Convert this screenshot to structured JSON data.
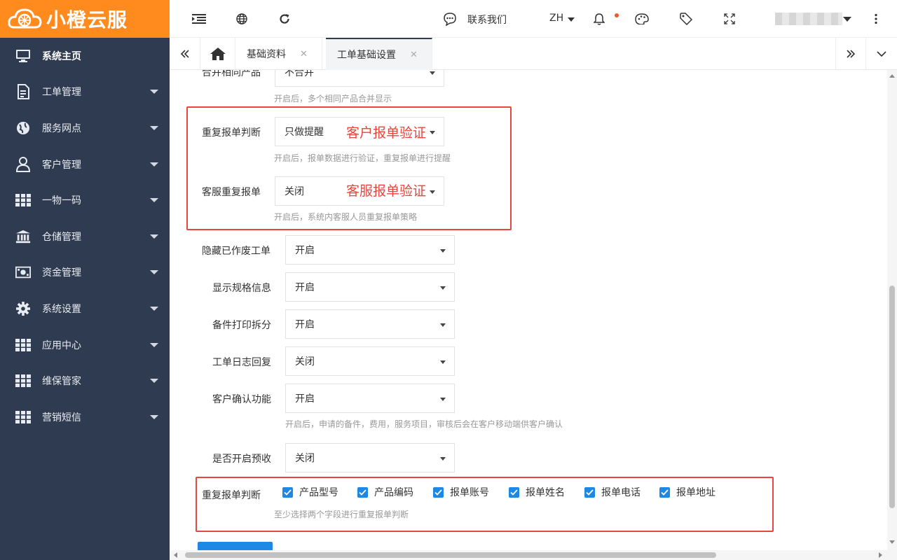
{
  "brand": {
    "name": "小橙云服"
  },
  "sidebar": {
    "items": [
      {
        "label": "系统主页",
        "icon": "monitor-icon"
      },
      {
        "label": "工单管理",
        "icon": "document-icon"
      },
      {
        "label": "服务网点",
        "icon": "globe-icon"
      },
      {
        "label": "客户管理",
        "icon": "user-icon"
      },
      {
        "label": "一物一码",
        "icon": "grid-icon"
      },
      {
        "label": "仓储管理",
        "icon": "bank-icon"
      },
      {
        "label": "资金管理",
        "icon": "money-icon"
      },
      {
        "label": "系统设置",
        "icon": "gear-icon"
      },
      {
        "label": "应用中心",
        "icon": "grid-icon"
      },
      {
        "label": "维保管家",
        "icon": "grid-icon"
      },
      {
        "label": "营销短信",
        "icon": "grid-icon"
      }
    ]
  },
  "topbar": {
    "contact_label": "联系我们",
    "language": "ZH"
  },
  "tabs": {
    "items": [
      {
        "label": "基础资料"
      },
      {
        "label": "工单基础设置"
      }
    ]
  },
  "form": {
    "merge": {
      "label": "合并相同产品",
      "value": "不合并",
      "hint": "开启后，多个相同产品合并显示"
    },
    "duplicate_check": {
      "label": "重复报单判断",
      "value": "只做提醒",
      "hint": "开启后，报单数据进行验证，重复报单进行提醒",
      "annotation": "客户报单验证"
    },
    "service_duplicate": {
      "label": "客服重复报单",
      "value": "关闭",
      "hint": "开启后，系统内客服人员重复报单策略",
      "annotation": "客服报单验证"
    },
    "hide_void": {
      "label": "隐藏已作废工单",
      "value": "开启"
    },
    "show_spec": {
      "label": "显示规格信息",
      "value": "开启"
    },
    "print_split": {
      "label": "备件打印拆分",
      "value": "开启"
    },
    "log_reply": {
      "label": "工单日志回复",
      "value": "关闭"
    },
    "customer_confirm": {
      "label": "客户确认功能",
      "value": "开启",
      "hint": "开启后，申请的备件，费用，服务项目，审核后会在客户移动端供客户确认"
    },
    "prepay": {
      "label": "是否开启预收",
      "value": "关闭"
    },
    "duplicate_fields": {
      "label": "重复报单判断",
      "options": [
        {
          "label": "产品型号",
          "checked": true
        },
        {
          "label": "产品编码",
          "checked": true
        },
        {
          "label": "报单账号",
          "checked": true
        },
        {
          "label": "报单姓名",
          "checked": true
        },
        {
          "label": "报单电话",
          "checked": true
        },
        {
          "label": "报单地址",
          "checked": true
        }
      ],
      "hint": "至少选择两个字段进行重复报单判断"
    }
  },
  "colors": {
    "brand": "#ff8a1d",
    "sidebar": "#2f3b50",
    "primary": "#1e88e5",
    "annotation": "#e5473e"
  }
}
